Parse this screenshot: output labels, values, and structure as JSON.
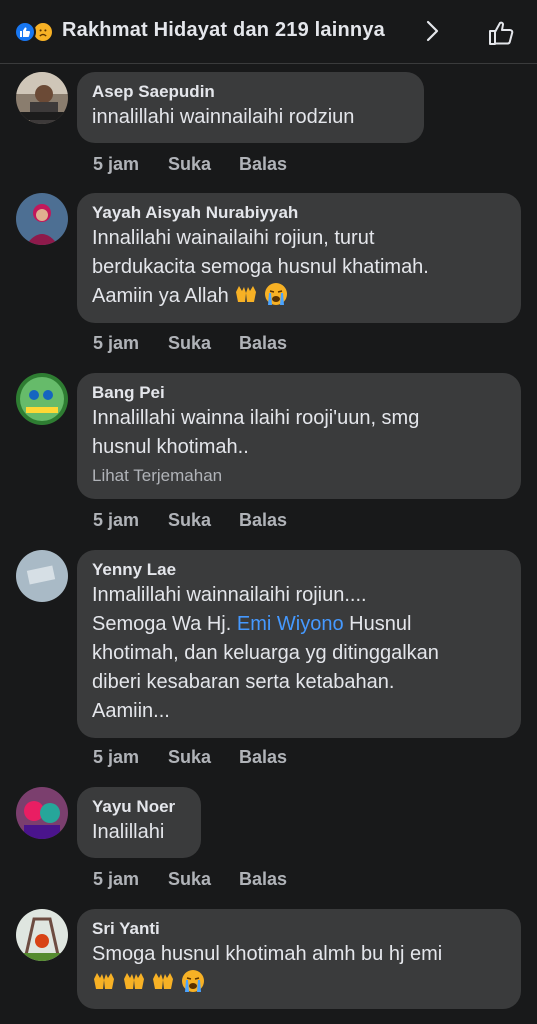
{
  "header": {
    "title": "Rakhmat Hidayat dan 219 lainnya",
    "reactions": [
      "like-icon",
      "sad-face-icon"
    ]
  },
  "comments": [
    {
      "author": "Asep Saepudin",
      "lines": [
        "innalillahi wainnailaihi rodziun"
      ],
      "time": "5 jam",
      "like": "Suka",
      "reply": "Balas"
    },
    {
      "author": "Yayah Aisyah Nurabiyyah",
      "lines": [
        "Innalilahi wainailaihi rojiun, turut",
        "berdukacita semoga husnul khatimah.",
        "Aamiin ya Allah"
      ],
      "time": "5 jam",
      "like": "Suka",
      "reply": "Balas"
    },
    {
      "author": "Bang Pei",
      "lines": [
        "Innalillahi wainna ilaihi rooji'uun, smg",
        "husnul khotimah.."
      ],
      "translate": "Lihat Terjemahan",
      "time": "5 jam",
      "like": "Suka",
      "reply": "Balas"
    },
    {
      "author": "Yenny Lae",
      "lines": [
        "Inmalillahi wainnailaihi rojiun....",
        "Semoga Wa Hj. ",
        "Emi Wiyono",
        " Husnul",
        "khotimah, dan keluarga yg ditinggalkan",
        "diberi kesabaran serta ketabahan.",
        "Aamiin..."
      ],
      "time": "5 jam",
      "like": "Suka",
      "reply": "Balas"
    },
    {
      "author": "Yayu Noer",
      "lines": [
        "Inalillahi"
      ],
      "time": "5 jam",
      "like": "Suka",
      "reply": "Balas"
    },
    {
      "author": "Sri Yanti",
      "lines": [
        "Smoga husnul khotimah almh bu hj emi"
      ],
      "time": "5 jam",
      "like": "Suka",
      "reply": "Balas"
    }
  ]
}
